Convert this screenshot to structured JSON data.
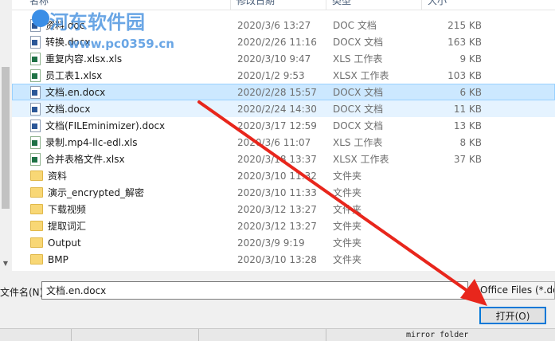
{
  "columns": {
    "name": "名称",
    "date": "修改日期",
    "type": "类型",
    "size": "大小"
  },
  "files": [
    {
      "name": "资料.doc",
      "date": "2020/3/6 13:27",
      "type": "DOC 文档",
      "size": "215 KB",
      "icon": "doc"
    },
    {
      "name": "转换.docx",
      "date": "2020/2/26 11:16",
      "type": "DOCX 文档",
      "size": "163 KB",
      "icon": "doc"
    },
    {
      "name": "重复内容.xlsx.xls",
      "date": "2020/3/10 9:47",
      "type": "XLS 工作表",
      "size": "9 KB",
      "icon": "xls"
    },
    {
      "name": "员工表1.xlsx",
      "date": "2020/1/2 9:53",
      "type": "XLSX 工作表",
      "size": "103 KB",
      "icon": "xls"
    },
    {
      "name": "文档.en.docx",
      "date": "2020/2/28 15:57",
      "type": "DOCX 文档",
      "size": "6 KB",
      "icon": "doc",
      "state": "selected"
    },
    {
      "name": "文档.docx",
      "date": "2020/2/24 14:30",
      "type": "DOCX 文档",
      "size": "11 KB",
      "icon": "doc",
      "state": "hover"
    },
    {
      "name": "文档(FILEminimizer).docx",
      "date": "2020/3/17 12:59",
      "type": "DOCX 文档",
      "size": "13 KB",
      "icon": "doc"
    },
    {
      "name": "录制.mp4-llc-edl.xls",
      "date": "2020/3/6 11:07",
      "type": "XLS 工作表",
      "size": "8 KB",
      "icon": "xls"
    },
    {
      "name": "合并表格文件.xlsx",
      "date": "2020/3/18 13:37",
      "type": "XLSX 工作表",
      "size": "37 KB",
      "icon": "xls"
    },
    {
      "name": "资料",
      "date": "2020/3/10 11:32",
      "type": "文件夹",
      "size": "",
      "icon": "folder"
    },
    {
      "name": "演示_encrypted_解密",
      "date": "2020/3/10 11:33",
      "type": "文件夹",
      "size": "",
      "icon": "folder"
    },
    {
      "name": "下载视频",
      "date": "2020/3/12 13:27",
      "type": "文件夹",
      "size": "",
      "icon": "folder"
    },
    {
      "name": "提取词汇",
      "date": "2020/3/12 13:27",
      "type": "文件夹",
      "size": "",
      "icon": "folder"
    },
    {
      "name": "Output",
      "date": "2020/3/9 9:19",
      "type": "文件夹",
      "size": "",
      "icon": "folder"
    },
    {
      "name": "BMP",
      "date": "2020/3/10 13:28",
      "type": "文件夹",
      "size": "",
      "icon": "folder"
    }
  ],
  "filename": {
    "label": "文件名(N):",
    "value": "文档.en.docx"
  },
  "filetype": {
    "value": "Office Files (*.doc"
  },
  "open_button": {
    "label": "打开(O)"
  },
  "watermark": {
    "title": "河东软件园",
    "url": "www.pc0359.cn"
  },
  "background_window": {
    "text": "mirror folder"
  },
  "colors": {
    "selected": "#cce8ff",
    "accent": "#0078d7",
    "annotation_arrow": "#e8261c"
  }
}
